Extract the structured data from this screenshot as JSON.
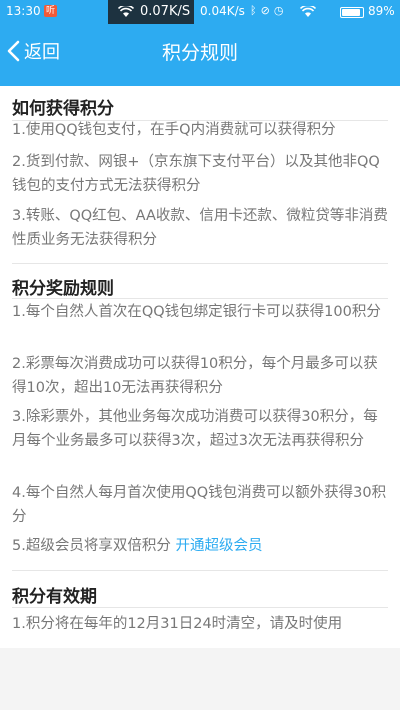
{
  "status_bar": {
    "time": "13:30",
    "notification_badge": "听",
    "speed_primary": "0.07K/S",
    "speed_secondary": "0.04K/s",
    "icons": [
      "bluetooth-icon",
      "alarm-icon",
      "clock-icon",
      "wifi-icon"
    ],
    "battery_level": 0.89,
    "battery_text": "89%"
  },
  "nav": {
    "back_label": "返回",
    "title": "积分规则"
  },
  "sections": [
    {
      "title": "如何获得积分",
      "items": [
        {
          "text": "1.使用QQ钱包支付，在手Q内消费就可以获得积分"
        },
        {
          "text": "2.货到付款、网银+（京东旗下支付平台）以及其他非QQ钱包的支付方式无法获得积分"
        },
        {
          "text": "3.转账、QQ红包、AA收款、信用卡还款、微粒贷等非消费性质业务无法获得积分"
        }
      ]
    },
    {
      "title": "积分奖励规则",
      "items": [
        {
          "text": "1.每个自然人首次在QQ钱包绑定银行卡可以获得100积分"
        },
        {
          "text": "2.彩票每次消费成功可以获得10积分，每个月最多可以获得10次，超出10无法再获得积分"
        },
        {
          "text": "3.除彩票外，其他业务每次成功消费可以获得30积分，每月每个业务最多可以获得3次，超过3次无法再获得积分"
        },
        {
          "text": "4.每个自然人每月首次使用QQ钱包消费可以额外获得30积分"
        },
        {
          "text": "5.超级会员将享双倍积分",
          "link": "开通超级会员"
        }
      ]
    },
    {
      "title": "积分有效期",
      "items": [
        {
          "text": "1.积分将在每年的12月31日24时清空，请及时使用"
        }
      ]
    }
  ],
  "colors": {
    "header": "#2dabf1",
    "link": "#2dabf1",
    "title_text": "#222222",
    "body_text": "#777777"
  }
}
